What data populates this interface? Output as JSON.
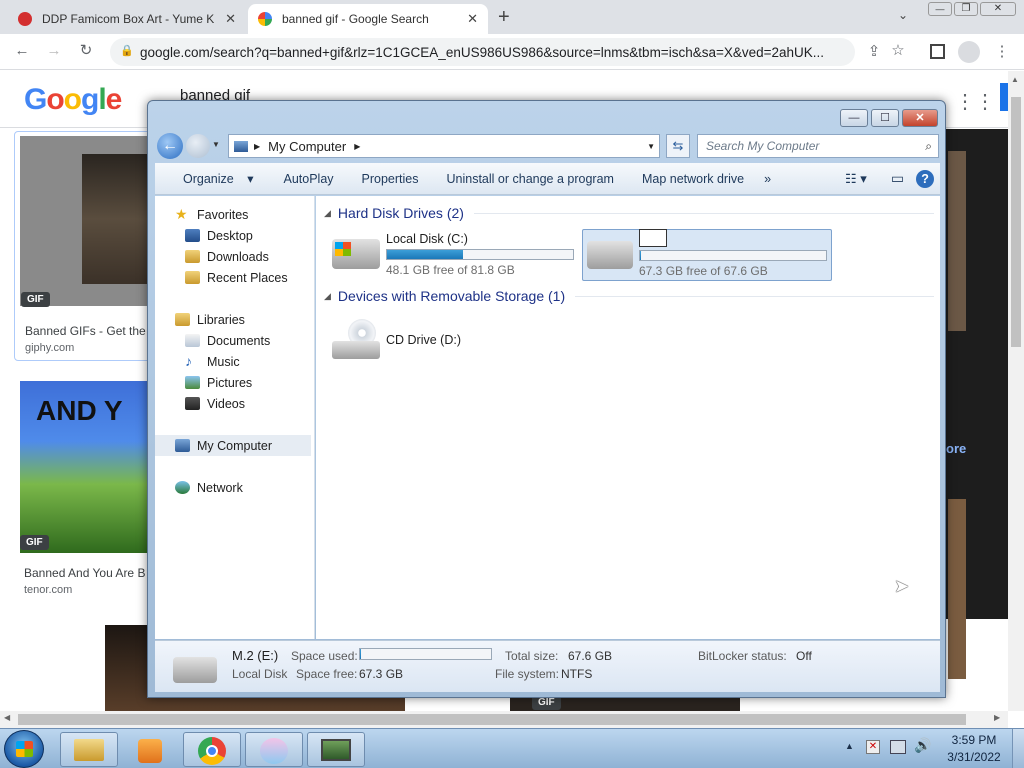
{
  "browser": {
    "tabs": [
      {
        "title": "DDP Famicom Box Art - Yume Kōjō",
        "active": false
      },
      {
        "title": "banned gif - Google Search",
        "active": true
      }
    ],
    "new_tab": "+",
    "url": "google.com/search?q=banned+gif&rlz=1C1GCEA_enUS986US986&source=lnms&tbm=isch&sa=X&ved=2ahUK...",
    "window_controls": {
      "minimize": "—",
      "restore": "❐",
      "close": "✕"
    }
  },
  "google": {
    "logo": "Google",
    "search_value": "banned gif",
    "results": [
      {
        "badge": "GIF",
        "title": "Banned GIFs - Get the",
        "source": "giphy.com"
      },
      {
        "badge": "GIF",
        "title": "Banned And You Are B",
        "source": "tenor.com",
        "overlay": "AND Y"
      },
      {
        "badge": "GIF"
      }
    ],
    "more_link": "ore"
  },
  "explorer": {
    "window_controls": {
      "minimize": "—",
      "maximize": "☐",
      "close": "✕"
    },
    "address": {
      "location": "My Computer"
    },
    "search_placeholder": "Search My Computer",
    "commands": [
      "Organize",
      "AutoPlay",
      "Properties",
      "Uninstall or change a program",
      "Map network drive",
      "»"
    ],
    "nav": {
      "favorites": {
        "label": "Favorites",
        "items": [
          "Desktop",
          "Downloads",
          "Recent Places"
        ]
      },
      "libraries": {
        "label": "Libraries",
        "items": [
          "Documents",
          "Music",
          "Pictures",
          "Videos"
        ]
      },
      "computer": "My Computer",
      "network": "Network"
    },
    "groups": {
      "hard_disks": {
        "label": "Hard Disk Drives (2)",
        "drives": [
          {
            "name": "Local Disk (C:)",
            "free_text": "48.1 GB free of 81.8 GB",
            "used_fraction": 0.41
          },
          {
            "name": "",
            "free_text": "67.3 GB free of 67.6 GB",
            "used_fraction": 0.005
          }
        ]
      },
      "removable": {
        "label": "Devices with Removable Storage (1)",
        "drives": [
          {
            "name": "CD Drive (D:)"
          }
        ]
      }
    },
    "details": {
      "name": "M.2 (E:)",
      "type": "Local Disk",
      "space_used_label": "Space used:",
      "space_used_fraction": 0.005,
      "space_free_label": "Space free:",
      "space_free": "67.3 GB",
      "total_size_label": "Total size:",
      "total_size": "67.6 GB",
      "file_system_label": "File system:",
      "file_system": "NTFS",
      "bitlocker_label": "BitLocker status:",
      "bitlocker": "Off"
    }
  },
  "taskbar": {
    "time": "3:59 PM",
    "date": "3/31/2022"
  }
}
